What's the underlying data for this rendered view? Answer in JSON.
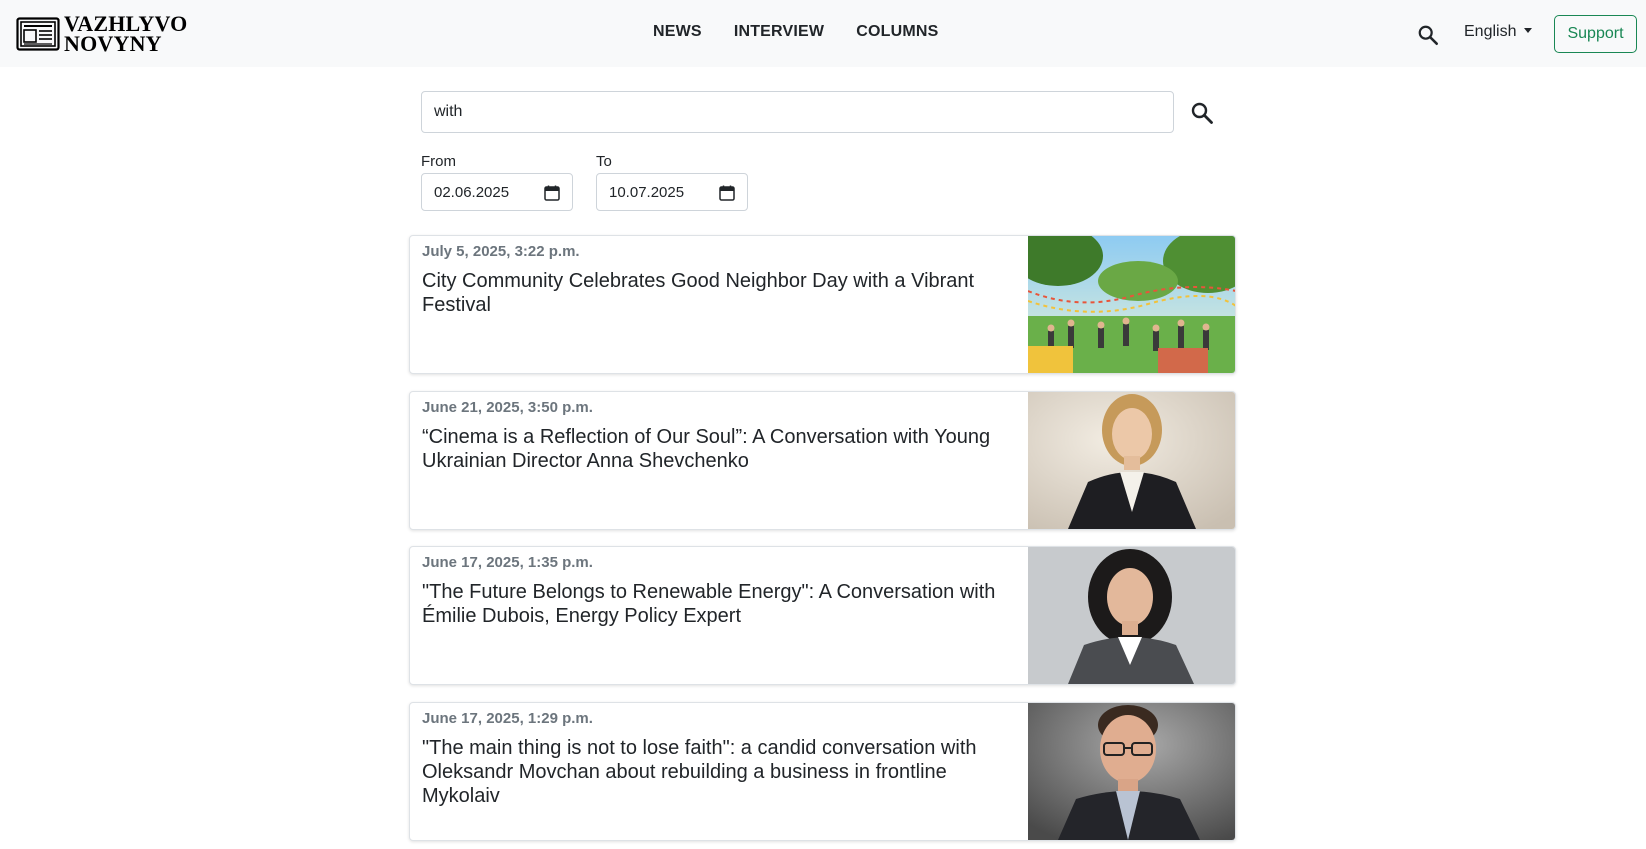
{
  "header": {
    "brand_line1": "VAZHLYVO",
    "brand_line2": "NOVYNY",
    "nav": [
      "NEWS",
      "INTERVIEW",
      "COLUMNS"
    ],
    "language": "English",
    "support_label": "Support",
    "accent_color": "#198754"
  },
  "search": {
    "query": "with",
    "from_label": "From",
    "from_value": "02.06.2025",
    "to_label": "To",
    "to_value": "10.07.2025"
  },
  "results": [
    {
      "date": "July 5, 2025, 3:22 p.m.",
      "title": "City Community Celebrates Good Neighbor Day with a Vibrant Festival",
      "image": "park-festival-photo"
    },
    {
      "date": "June 21, 2025, 3:50 p.m.",
      "title": "“Cinema is a Reflection of Our Soul”: A Conversation with Young Ukrainian Director Anna Shevchenko",
      "image": "blonde-woman-portrait"
    },
    {
      "date": "June 17, 2025, 1:35 p.m.",
      "title": "\"The Future Belongs to Renewable Energy\": A Conversation with Émilie Dubois, Energy Policy Expert",
      "image": "dark-haired-woman-portrait"
    },
    {
      "date": "June 17, 2025, 1:29 p.m.",
      "title": "\"The main thing is not to lose faith\": a candid conversation with Oleksandr Movchan about rebuilding a business in frontline Mykolaiv",
      "image": "man-glasses-portrait"
    }
  ]
}
